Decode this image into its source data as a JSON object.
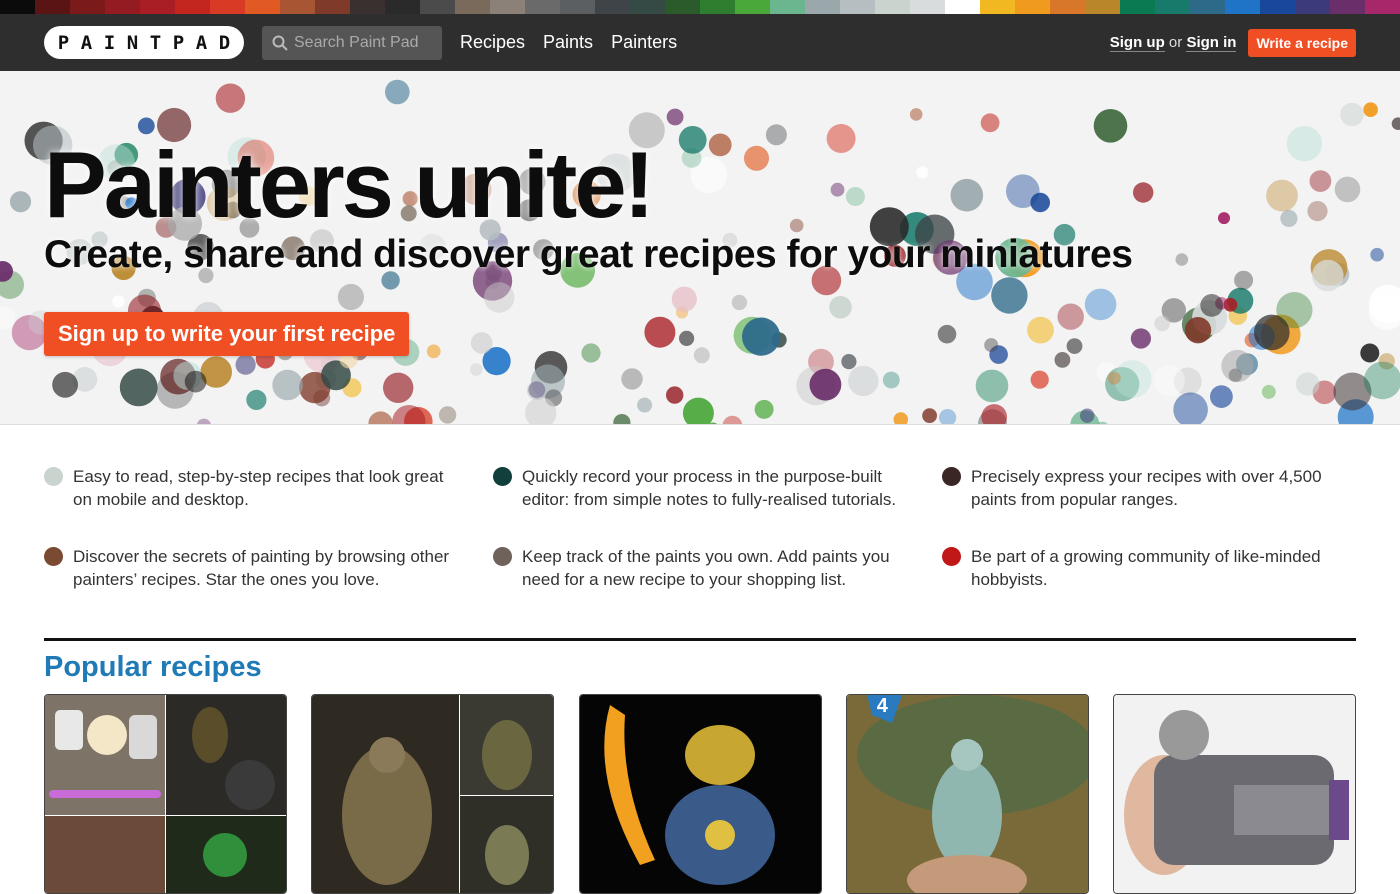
{
  "swatches": [
    "#0b0b0b",
    "#5a1414",
    "#7a1a1a",
    "#951b22",
    "#a91e24",
    "#c2261f",
    "#d83a26",
    "#e15a23",
    "#a85533",
    "#7f3a2a",
    "#3a3030",
    "#2a2a2a",
    "#4b4b4b",
    "#7a6a5c",
    "#8b8178",
    "#6a6a6a",
    "#5b5f62",
    "#3e4448",
    "#354a45",
    "#2b5a2b",
    "#2f7d2f",
    "#4aa83a",
    "#6bb58f",
    "#9aa8ac",
    "#b6bec2",
    "#c9d4cf",
    "#d8dcdc",
    "#ffffff",
    "#f2b822",
    "#f09a1e",
    "#d8762a",
    "#b9862a",
    "#0a7a52",
    "#177a6a",
    "#2d6a8a",
    "#1f74c8",
    "#19489a",
    "#3d3a7a",
    "#6a2f6a",
    "#a6286a"
  ],
  "nav": {
    "logo_letters": [
      "P",
      "A",
      "I",
      "N",
      "T",
      "P",
      "A",
      "D"
    ],
    "search_placeholder": "Search Paint Pad",
    "links": [
      "Recipes",
      "Paints",
      "Painters"
    ],
    "sign_up": "Sign up",
    "or": "or",
    "sign_in": "Sign in",
    "write_recipe": "Write a recipe"
  },
  "hero": {
    "title": "Painters unite!",
    "subtitle": "Create, share and discover great recipes for your miniatures",
    "cta": "Sign up to write your first recipe"
  },
  "features": [
    {
      "color": "#c9d4cf",
      "text": "Easy to read, step-by-step recipes that look great on mobile and desktop."
    },
    {
      "color": "#103f3c",
      "text": "Quickly record your process in the purpose-built editor: from simple notes to fully-realised tutorials."
    },
    {
      "color": "#3a2624",
      "text": "Precisely express your recipes with over 4,500 paints from popular ranges."
    },
    {
      "color": "#7a4a33",
      "text": "Discover the secrets of painting by browsing other painters’ recipes. Star the ones you love."
    },
    {
      "color": "#6e625a",
      "text": "Keep track of the paints you own. Add paints you need for a new recipe to your shopping list."
    },
    {
      "color": "#c01818",
      "text": "Be part of a growing community of like-minded hobbyists."
    }
  ],
  "popular": {
    "title": "Popular recipes",
    "card_badge": "4"
  }
}
